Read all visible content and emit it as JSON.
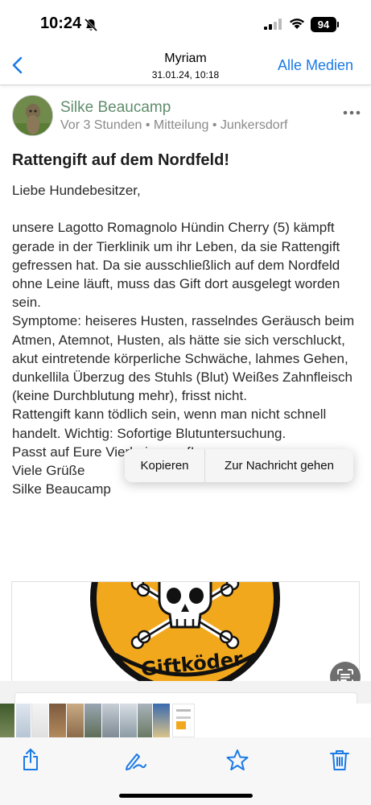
{
  "status": {
    "time": "10:24",
    "battery": "94"
  },
  "nav": {
    "title": "Myriam",
    "subtitle": "31.01.24, 10:18",
    "right_label": "Alle Medien"
  },
  "post": {
    "author": "Silke Beaucamp",
    "meta": "Vor 3 Stunden • Mitteilung • Junkersdorf",
    "title": "Rattengift auf dem Nordfeld!",
    "body": "Liebe Hundebesitzer,\n\nunsere Lagotto Romagnolo Hündin Cherry (5) kämpft gerade in der Tierklinik um ihr Leben, da sie Rattengift gefressen hat. Da sie ausschließlich auf dem Nordfeld ohne Leine läuft, muss das Gift dort ausgelegt worden sein.\nSymptome: heiseres Husten, rasselndes Geräusch beim Atmen, Atemnot, Husten, als hätte sie sich verschluckt, akut eintretende körperliche Schwäche, lahmes Gehen, dunkellila Überzug des Stuhls (Blut) Weißes Zahnfleisch (keine Durchblutung mehr), frisst nicht.\nRattengift kann tödlich sein, wenn man nicht schnell handelt. Wichtig: Sofortige Blutuntersuchung.\nPasst auf Eure Vierbeiner auf!\nViele Grüße\nSilke Beaucamp"
  },
  "attachment": {
    "sign_text": "Giftköder"
  },
  "context_menu": {
    "copy": "Kopieren",
    "goto": "Zur Nachricht gehen"
  },
  "colors": {
    "accent": "#1a7ae6",
    "author": "#5f8d6b",
    "sign_yellow": "#f2a81d"
  },
  "icons": {
    "back": "chevron-left-icon",
    "more": "ellipsis-icon",
    "share": "share-icon",
    "markup": "markup-pen-icon",
    "favorite": "star-icon",
    "delete": "trash-icon",
    "live_text": "live-text-icon"
  }
}
